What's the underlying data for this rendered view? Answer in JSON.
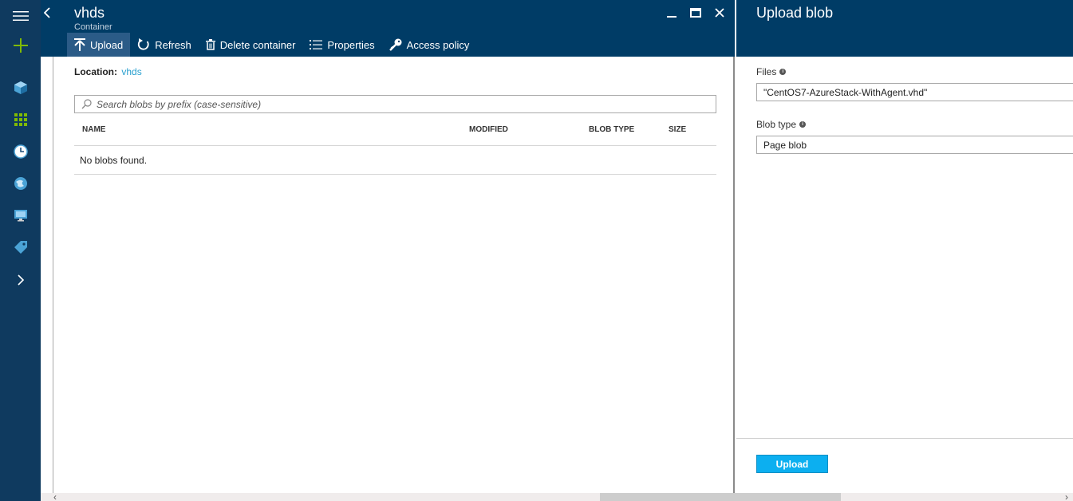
{
  "blade_container": {
    "title": "vhds",
    "subtitle": "Container",
    "toolbar": {
      "upload": "Upload",
      "refresh": "Refresh",
      "delete_container": "Delete container",
      "properties": "Properties",
      "access_policy": "Access policy"
    },
    "location_label": "Location:",
    "location_value": "vhds",
    "search_placeholder": "Search blobs by prefix (case-sensitive)",
    "columns": [
      "NAME",
      "MODIFIED",
      "BLOB TYPE",
      "SIZE"
    ],
    "empty_message": "No blobs found."
  },
  "blade_upload": {
    "title": "Upload blob",
    "files_label": "Files",
    "files_value": "\"CentOS7-AzureStack-WithAgent.vhd\"",
    "blob_type_label": "Blob type",
    "blob_type_value": "Page blob",
    "upload_button": "Upload"
  },
  "nav_icons": [
    "hamburger-icon",
    "new-plus-icon",
    "resource-cube-icon",
    "all-resources-grid-icon",
    "recent-clock-icon",
    "global-network-icon",
    "virtual-machine-icon",
    "tag-icon",
    "expand-chevron-icon"
  ],
  "colors": {
    "nav_bg": "#0f3a5f",
    "header_bg": "#003c66",
    "accent_link": "#2aa0cf",
    "upload_button": "#0caff0",
    "plus_green": "#7fba00"
  }
}
